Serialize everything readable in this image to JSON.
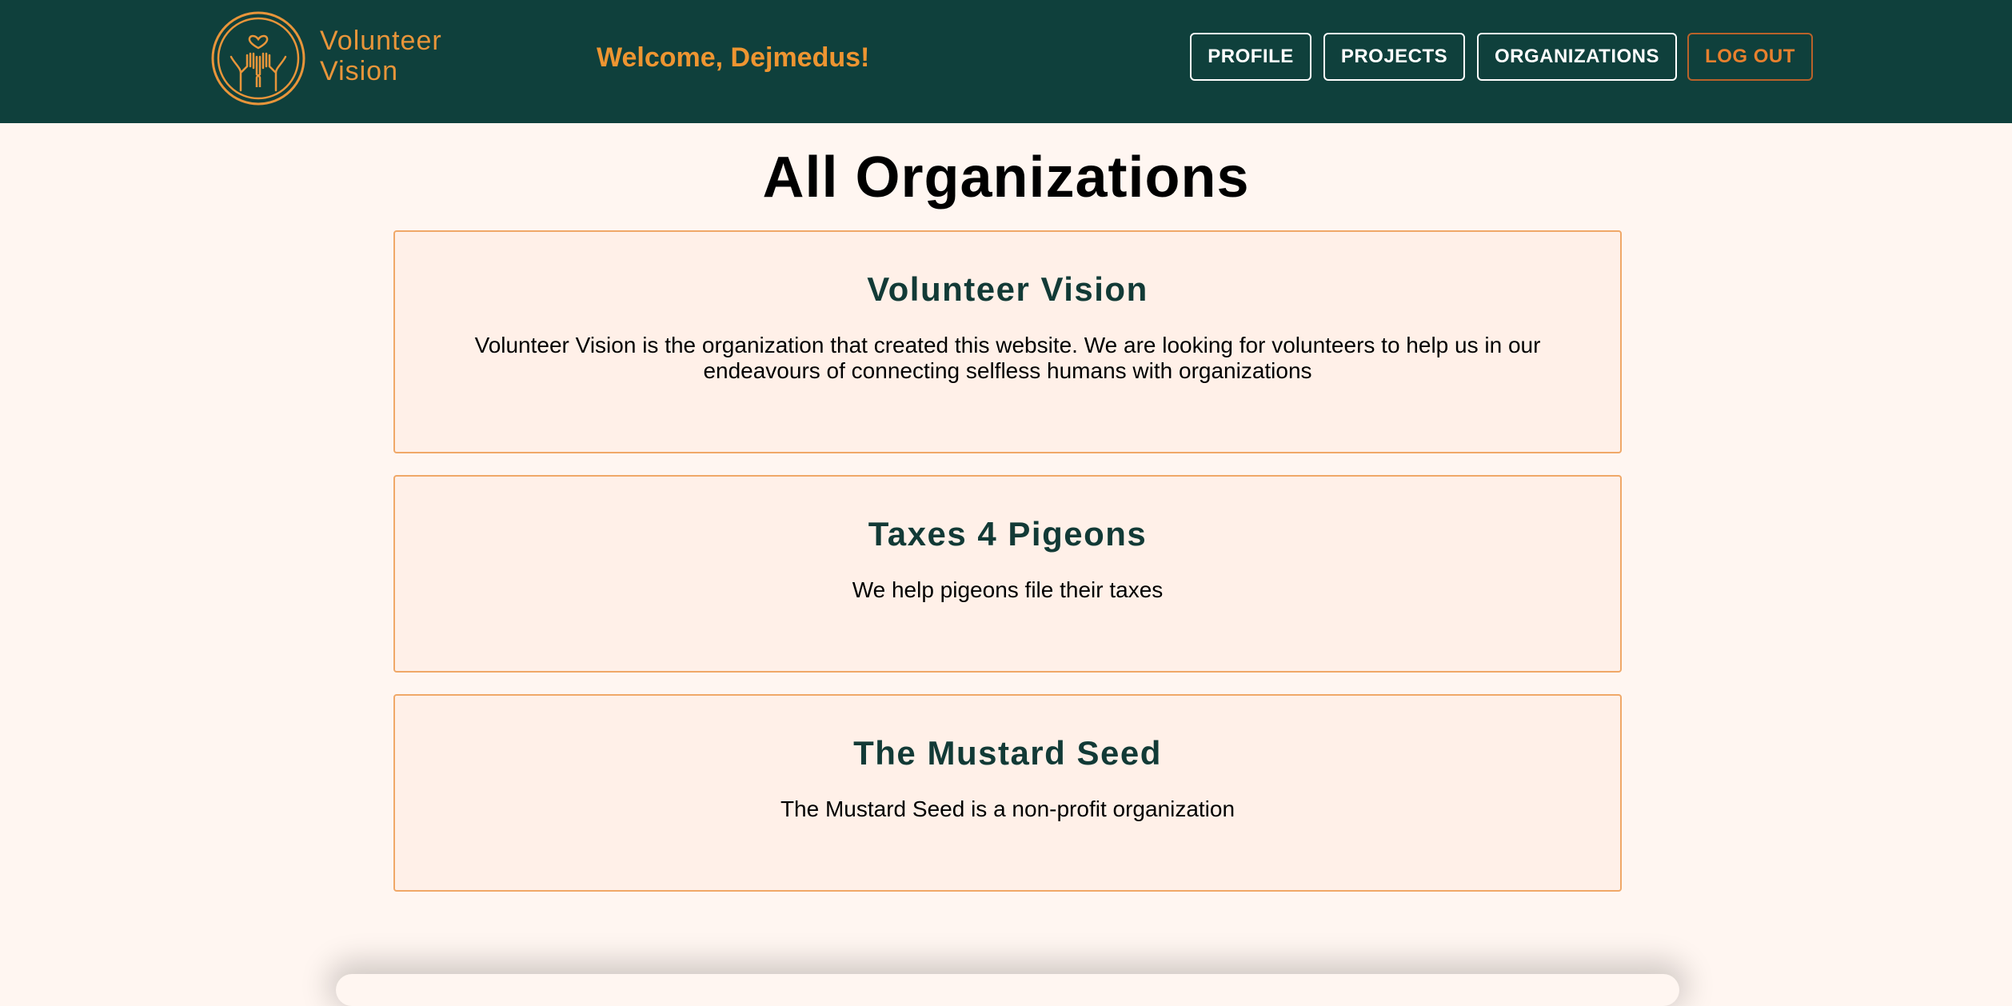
{
  "header": {
    "brand_line1": "Volunteer",
    "brand_line2": "Vision",
    "welcome": "Welcome, Dejmedus!",
    "nav": {
      "profile": "PROFILE",
      "projects": "PROJECTS",
      "organizations": "ORGANIZATIONS",
      "logout": "LOG OUT"
    },
    "logo_icon": "hands-heart-icon"
  },
  "main": {
    "title": "All Organizations",
    "organizations": [
      {
        "name": "Volunteer Vision",
        "description": "Volunteer Vision is the organization that created this website. We are looking for volunteers to help us in our endeavours of connecting selfless humans with organizations"
      },
      {
        "name": "Taxes 4 Pigeons",
        "description": "We help pigeons file their taxes"
      },
      {
        "name": "The Mustard Seed",
        "description": "The Mustard Seed is a non-profit organization"
      }
    ]
  },
  "colors": {
    "navbar_bg": "#0f403c",
    "accent_orange": "#ee9531",
    "page_bg": "#fff6f1",
    "card_border": "#f0a868",
    "card_title": "#123a36"
  }
}
